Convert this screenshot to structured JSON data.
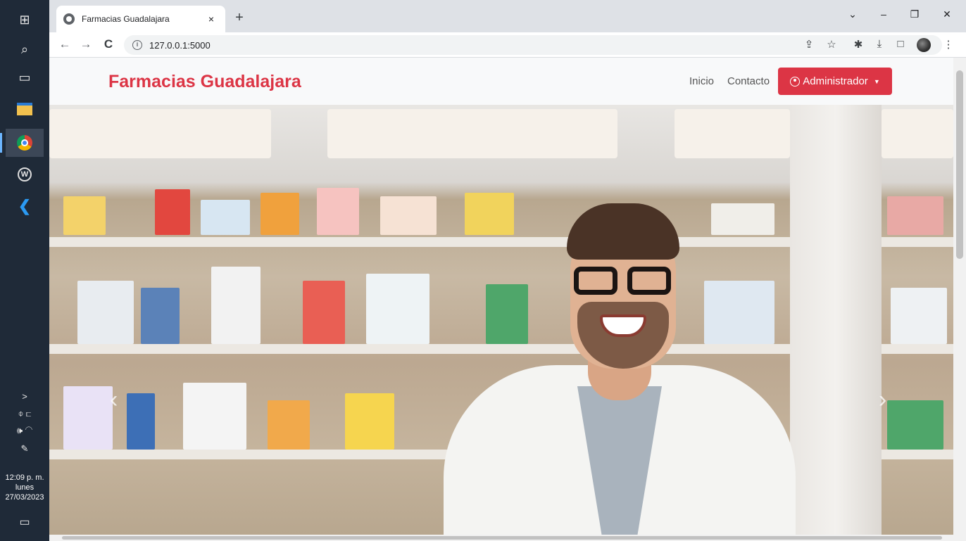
{
  "taskbar": {
    "icons": [
      "windows-start-icon",
      "search-icon",
      "task-view-icon",
      "file-explorer-icon",
      "chrome-icon",
      "app-w-icon",
      "vscode-icon"
    ],
    "tray_expand": ">",
    "clock": {
      "time": "12:09 p. m.",
      "day": "lunes",
      "date": "27/03/2023"
    }
  },
  "browser": {
    "tab": {
      "title": "Farmacias Guadalajara",
      "close": "×"
    },
    "new_tab": "+",
    "window_controls": {
      "collapse": "⌄",
      "minimize": "–",
      "restore": "❐",
      "close": "✕"
    },
    "nav": {
      "back": "←",
      "forward": "→",
      "reload": "C"
    },
    "address": {
      "url": "127.0.0.1:5000",
      "info": "i"
    },
    "toolbar_icons": {
      "share": "⇪",
      "bookmark": "☆",
      "extensions": "✱",
      "download": "⤓",
      "sidepanel": "□",
      "menu": "⋮"
    }
  },
  "page": {
    "brand": "Farmacias Guadalajara",
    "nav": {
      "home": "Inicio",
      "contact": "Contacto"
    },
    "admin_button": "Administrador",
    "carousel": {
      "prev": "‹",
      "next": "›"
    }
  },
  "colors": {
    "brand_red": "#dc3545",
    "navbar_bg": "#f8f9fa",
    "taskbar_bg": "#1f2a38"
  }
}
